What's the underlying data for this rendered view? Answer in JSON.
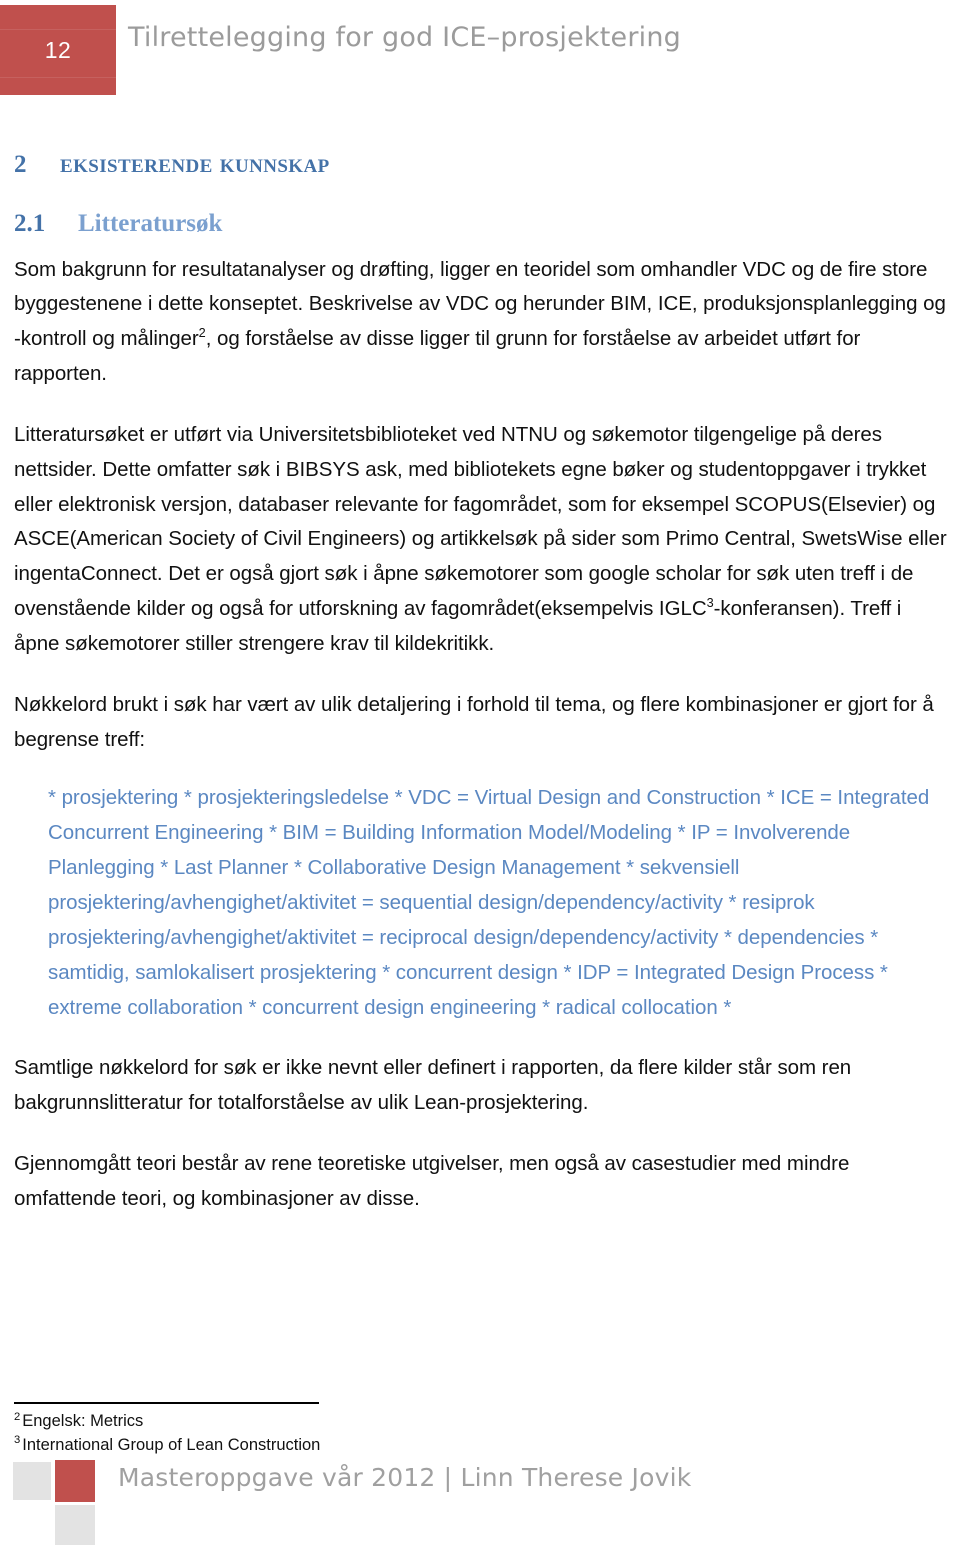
{
  "header": {
    "page_number": "12",
    "document_title": "Tilrettelegging for god ICE–prosjektering",
    "accent_color": "#C0504D",
    "title_color": "#9b9b9b"
  },
  "section": {
    "number": "2",
    "title": "Eksisterende kunnskap",
    "heading_color": "#4472A8"
  },
  "subsection": {
    "number": "2.1",
    "title": "Litteratursøk",
    "number_color": "#4472A8",
    "title_color": "#7BA0CF"
  },
  "body": {
    "paragraph_1_part_1": "Som bakgrunn for resultatanalyser og drøfting, ligger en teoridel som omhandler VDC og de fire store byggestenene i dette konseptet. Beskrivelse av VDC og herunder BIM, ICE, produksjonsplanlegging og -kontroll og målinger",
    "paragraph_1_footnote_ref": "2",
    "paragraph_1_part_2": ", og forståelse av disse ligger til grunn for forståelse av arbeidet utført for rapporten.",
    "paragraph_2_part_1": "Litteratursøket er utført via Universitetsbiblioteket ved NTNU og søkemotor tilgengelige på deres nettsider. Dette omfatter søk i BIBSYS ask, med bibliotekets egne bøker og studentoppgaver i trykket eller elektronisk versjon, databaser relevante for fagområdet, som for eksempel SCOPUS(Elsevier) og ASCE(American Society of Civil Engineers) og artikkelsøk på sider som Primo Central, SwetsWise eller ingentaConnect.  Det er også gjort søk i åpne søkemotorer som google scholar for søk uten treff i de ovenstående kilder og også for utforskning av fagområdet(eksempelvis IGLC",
    "paragraph_2_footnote_ref": "3",
    "paragraph_2_part_2": "-konferansen). Treff i åpne søkemotorer stiller strengere krav til kildekritikk.",
    "paragraph_3": "Nøkkelord brukt i søk har vært av ulik detaljering i forhold til tema, og flere kombinasjoner er gjort for å begrense treff:",
    "keywords_block": "* prosjektering * prosjekteringsledelse * VDC = Virtual Design and Construction * ICE = Integrated Concurrent Engineering * BIM = Building Information Model/Modeling * IP = Involverende Planlegging * Last Planner * Collaborative Design Management * sekvensiell prosjektering/avhengighet/aktivitet = sequential design/dependency/activity * resiprok prosjektering/avhengighet/aktivitet = reciprocal design/dependency/activity * dependencies * samtidig, samlokalisert prosjektering * concurrent design * IDP = Integrated Design Process * extreme collaboration * concurrent design engineering * radical collocation *",
    "keywords_color": "#5B88C2",
    "paragraph_4": "Samtlige nøkkelord for søk er ikke nevnt eller definert i rapporten, da flere kilder står som ren bakgrunnslitteratur for totalforståelse av ulik Lean-prosjektering.",
    "paragraph_5": "Gjennomgått teori består av rene teoretiske utgivelser, men også av casestudier med mindre omfattende teori, og kombinasjoner av disse."
  },
  "footnotes": [
    {
      "marker": "2",
      "text": "Engelsk: Metrics"
    },
    {
      "marker": "3",
      "text": "International Group of Lean Construction"
    }
  ],
  "footer": {
    "text": "Masteroppgave vår 2012  |  Linn Therese Jovik",
    "text_color": "#a0a0a0",
    "square_red": "#C0504D",
    "square_gray": "#E3E3E3"
  }
}
